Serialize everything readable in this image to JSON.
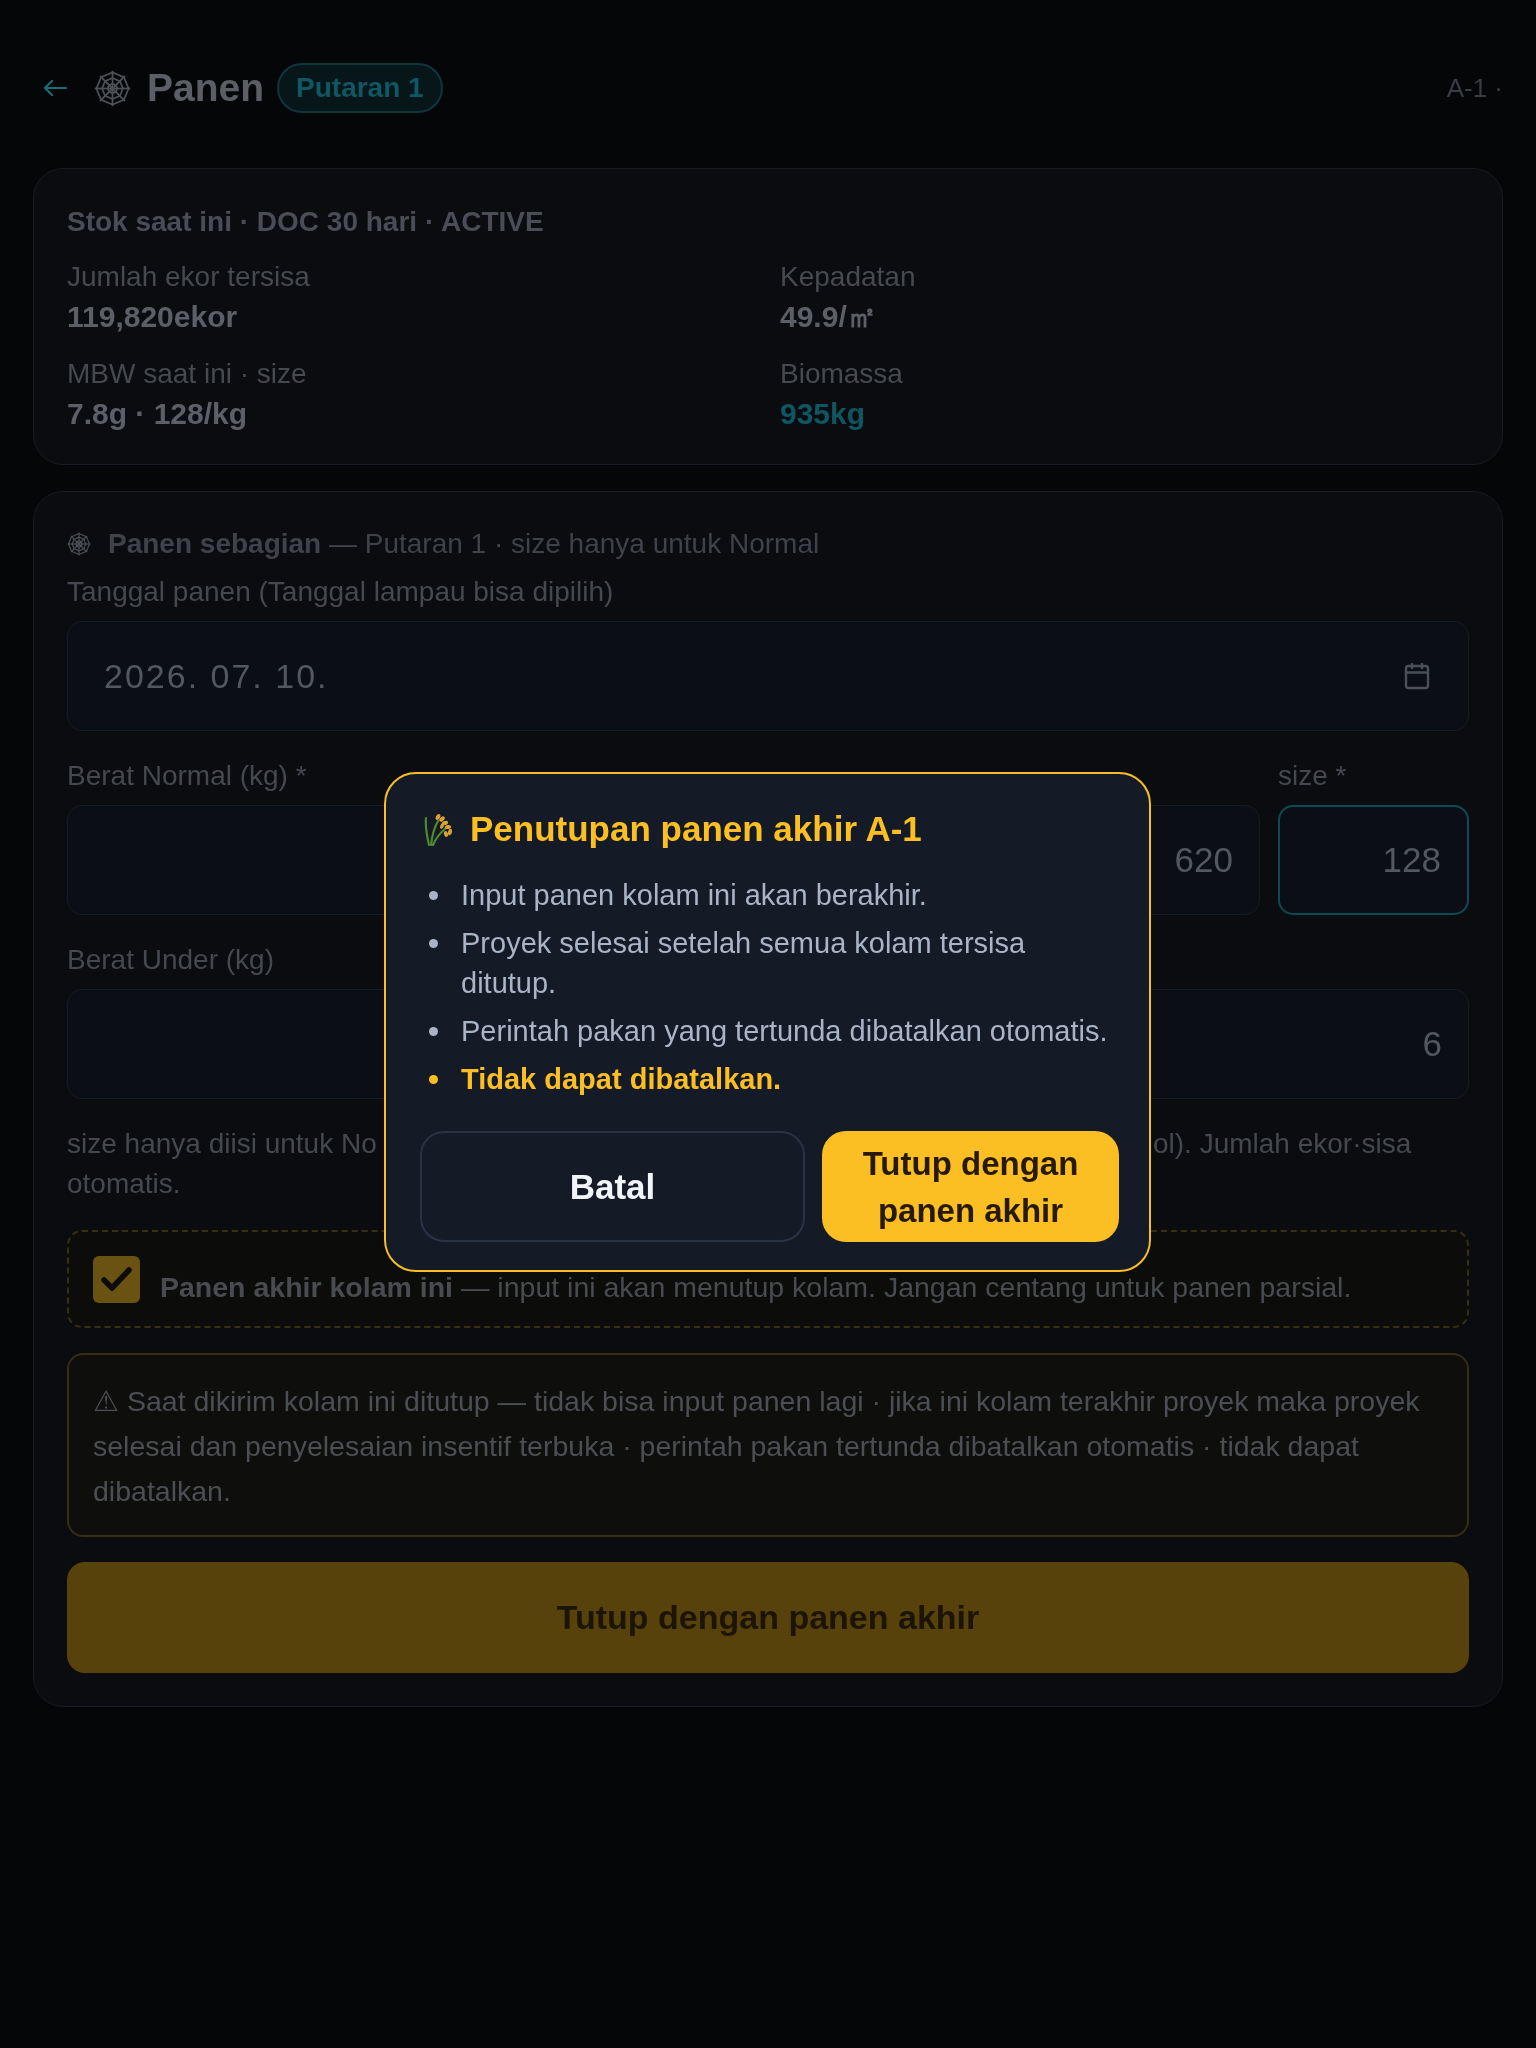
{
  "header": {
    "title": "Panen",
    "badge": "Putaran 1",
    "pond_code": "A-1 ·"
  },
  "stock_card": {
    "title": "Stok saat ini · DOC 30 hari · ACTIVE",
    "stats": [
      {
        "label": "Jumlah ekor tersisa",
        "value": "119,820ekor",
        "kind": "normal"
      },
      {
        "label": "Kepadatan",
        "value": "49.9/㎡",
        "kind": "normal"
      },
      {
        "label": "MBW saat ini · size",
        "value": "7.8g · 128/kg",
        "kind": "normal"
      },
      {
        "label": "Biomassa",
        "value": "935kg",
        "kind": "highlight"
      }
    ]
  },
  "harvest_form": {
    "section_title": "**Panen sebagian** — Putaran 1 · size hanya untuk Normal",
    "date_field": {
      "label": "Tanggal panen (Tanggal lampau bisa dipilih)",
      "value": "2026. 07. 10."
    },
    "normal_weight_field": {
      "label": "Berat Normal (kg) *",
      "value": "620"
    },
    "size_field": {
      "label": "size *",
      "value": "128",
      "focused": true
    },
    "under_weight_field": {
      "label": "Berat Under (kg)",
      "value": "6"
    },
    "help_text_fragments": [
      "size hanya diisi untuk No",
      "ol). Jumlah ekor·sisa",
      "otomatis."
    ],
    "final_harvest_checkbox": {
      "text": "**Panen akhir kolam ini** — input ini akan menutup kolam. Jangan centang untuk panen parsial.",
      "checked": true
    },
    "warning_text": "⚠ Saat dikirim kolam ini ditutup — tidak bisa input panen lagi · jika ini kolam terakhir proyek maka proyek selesai dan penyelesaian insentif terbuka · perintah pakan tertunda dibatalkan otomatis · tidak dapat dibatalkan.",
    "submit_button": "Tutup dengan panen akhir"
  },
  "dialog": {
    "title": "Penutupan panen akhir A-1",
    "items": [
      {
        "text": "Input panen kolam ini akan berakhir.",
        "kind": "info"
      },
      {
        "text": "Proyek selesai setelah semua kolam tersisa ditutup.",
        "kind": "info"
      },
      {
        "text": "Perintah pakan yang tertunda dibatalkan otomatis.",
        "kind": "info"
      },
      {
        "text": "Tidak dapat dibatalkan.",
        "kind": "warning"
      }
    ],
    "buttons": [
      {
        "label": "Batal",
        "kind": "secondary"
      },
      {
        "label": "Tutup dengan panen akhir",
        "kind": "primary"
      }
    ]
  }
}
